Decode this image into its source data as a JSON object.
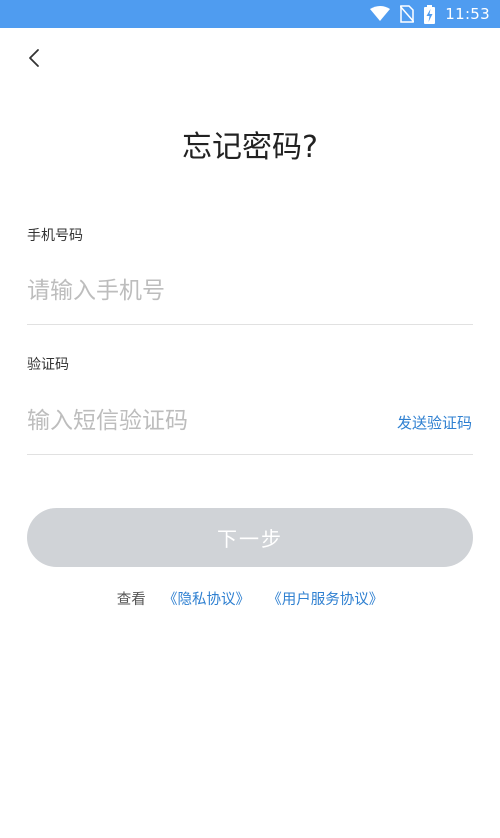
{
  "status_bar": {
    "time": "11:53",
    "icons": [
      "wifi-icon",
      "no-sim-icon",
      "battery-charging-icon"
    ],
    "background_color": "#4f9cf0"
  },
  "nav": {
    "back_icon": "chevron-left-icon"
  },
  "page": {
    "title": "忘记密码?"
  },
  "form": {
    "phone": {
      "label": "手机号码",
      "placeholder": "请输入手机号",
      "value": ""
    },
    "code": {
      "label": "验证码",
      "placeholder": "输入短信验证码",
      "value": "",
      "send_label": "发送验证码"
    },
    "next_label": "下一步"
  },
  "agreement": {
    "prefix": "查看",
    "privacy_link": "《隐私协议》",
    "terms_link": "《用户服务协议》"
  },
  "colors": {
    "accent": "#2f80d1",
    "button_disabled": "#d0d3d7"
  }
}
